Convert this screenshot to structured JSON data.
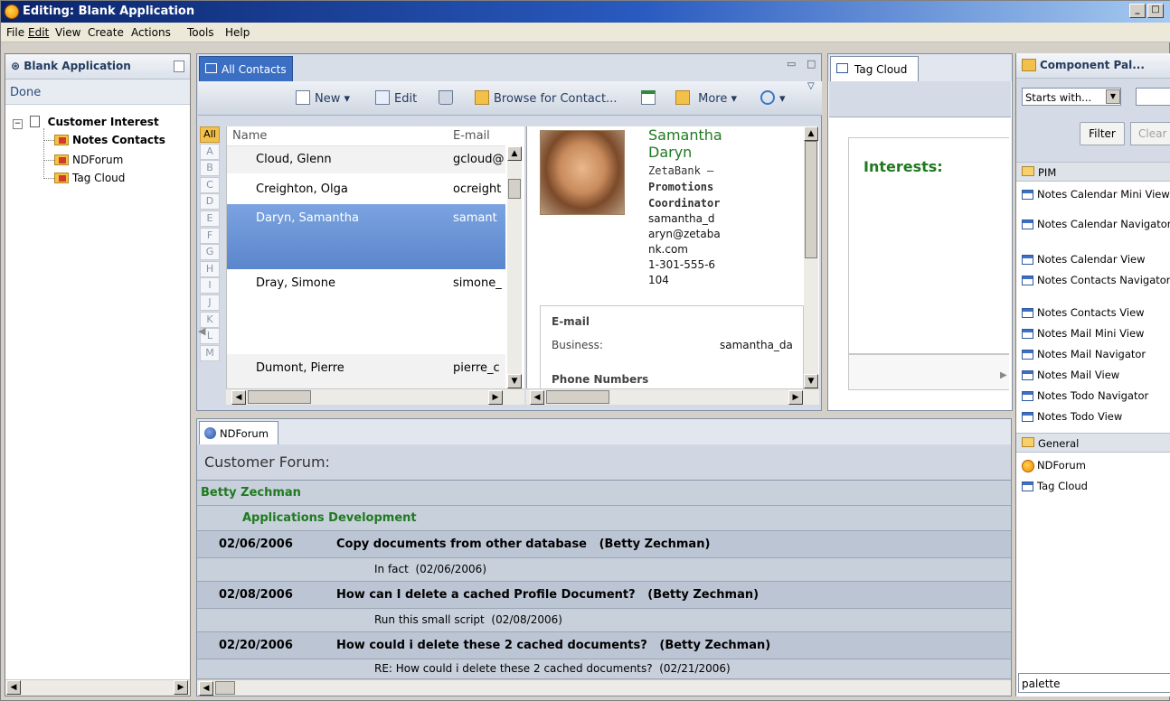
{
  "window": {
    "title": "Editing: Blank Application"
  },
  "menu": [
    "File",
    "Edit",
    "View",
    "Create",
    "Actions",
    "Tools",
    "Help"
  ],
  "left_nav": {
    "header": "Blank Application",
    "status": "Done",
    "tree": [
      {
        "label": "Customer Interest",
        "level": 0,
        "bold": true,
        "icon": "document-icon"
      },
      {
        "label": "Notes Contacts",
        "level": 1,
        "bold": true,
        "icon": "component-icon"
      },
      {
        "label": "NDForum",
        "level": 1,
        "bold": false,
        "icon": "component-icon"
      },
      {
        "label": "Tag Cloud",
        "level": 1,
        "bold": false,
        "icon": "component-icon"
      }
    ]
  },
  "contacts": {
    "tab": "All Contacts",
    "toolbar": {
      "new": "New",
      "edit": "Edit",
      "browse": "Browse for Contact...",
      "more": "More"
    },
    "alpha": [
      "All",
      "A",
      "B",
      "C",
      "D",
      "E",
      "F",
      "G",
      "H",
      "I",
      "J",
      "K",
      "L",
      "M"
    ],
    "columns": {
      "name": "Name",
      "email": "E-mail"
    },
    "rows": [
      {
        "name": "Cloud, Glenn",
        "email": "gcloud@"
      },
      {
        "name": "Creighton, Olga",
        "email": "ocreight"
      },
      {
        "name": "Daryn, Samantha",
        "email": "samant"
      },
      {
        "name": "Dray, Simone",
        "email": "simone_"
      },
      {
        "name": "Dumont, Pierre",
        "email": "pierre_c"
      }
    ],
    "selected_index": 2,
    "detail": {
      "first": "Samantha",
      "last": "Daryn",
      "company": "ZetaBank —",
      "title1": "Promotions",
      "title2": "Coordinator",
      "email_lines": [
        "samantha_d",
        "aryn@zetaba",
        "nk.com"
      ],
      "phone_lines": [
        "1-301-555-6",
        "104"
      ],
      "email_heading": "E-mail",
      "business_label": "Business:",
      "business_value": "samantha_da",
      "phone_heading": "Phone Numbers"
    }
  },
  "tag_cloud": {
    "tab": "Tag Cloud",
    "heading": "Interests:"
  },
  "palette": {
    "title": "Component Pal...",
    "filter_mode": "Starts with...",
    "filter_button": "Filter",
    "clear_button": "Clear",
    "group_pim": "PIM",
    "pim_items": [
      "Notes Calendar Mini View",
      "Notes Calendar Navigator",
      "Notes Calendar View",
      "Notes Contacts Navigator",
      "Notes Contacts View",
      "Notes Mail Mini View",
      "Notes Mail Navigator",
      "Notes Mail View",
      "Notes Todo Navigator",
      "Notes Todo View"
    ],
    "group_general": "General",
    "general_items": [
      "NDForum",
      "Tag Cloud"
    ],
    "search_value": "palette"
  },
  "forum": {
    "tab": "NDForum",
    "heading": "Customer Forum:",
    "author": "Betty Zechman",
    "category": "Applications Development",
    "topics": [
      {
        "date": "02/06/2006",
        "title": "Copy documents from other database   (Betty Zechman)",
        "reply": "In fact  (02/06/2006)"
      },
      {
        "date": "02/08/2006",
        "title": "How can I delete a cached Profile Document?   (Betty Zechman)",
        "reply": "Run this small script  (02/08/2006)"
      },
      {
        "date": "02/20/2006",
        "title": "How could i delete these 2 cached documents?   (Betty Zechman)",
        "reply": "RE: How could i delete these 2 cached documents?  (02/21/2006)"
      }
    ]
  },
  "colors": {
    "accent_green": "#1f7a1f",
    "selection": "#6b93d6",
    "nav_text": "#243b5e"
  }
}
